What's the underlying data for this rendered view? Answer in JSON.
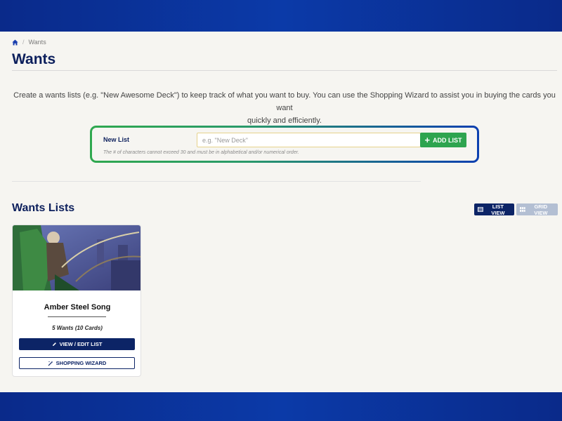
{
  "breadcrumb": {
    "home_icon": "home-icon",
    "current": "Wants"
  },
  "page": {
    "title": "Wants"
  },
  "intro": {
    "line1": "Create a wants lists (e.g. \"New Awesome Deck\") to keep track of what you want to buy. You can use the Shopping Wizard to assist you in buying the cards you want",
    "line2": "quickly and efficiently."
  },
  "new_list": {
    "label": "New List",
    "input_value": "",
    "input_placeholder": "e.g. \"New Deck\"",
    "add_button": "ADD LIST",
    "hint": "The # of characters cannot exceed 30 and must be in alphabetical and/or numerical order."
  },
  "wants_lists": {
    "title": "Wants Lists",
    "list_view": "LIST VIEW",
    "grid_view": "GRID VIEW",
    "cards": [
      {
        "name": "Amber Steel Song",
        "count": "5 Wants (10 Cards)",
        "edit_button": "VIEW / EDIT LIST",
        "wizard_button": "SHOPPING WIZARD"
      }
    ]
  },
  "colors": {
    "brand_navy": "#0c2466",
    "add_green": "#2ea44f",
    "frame_blue": "#0b3aa8"
  }
}
